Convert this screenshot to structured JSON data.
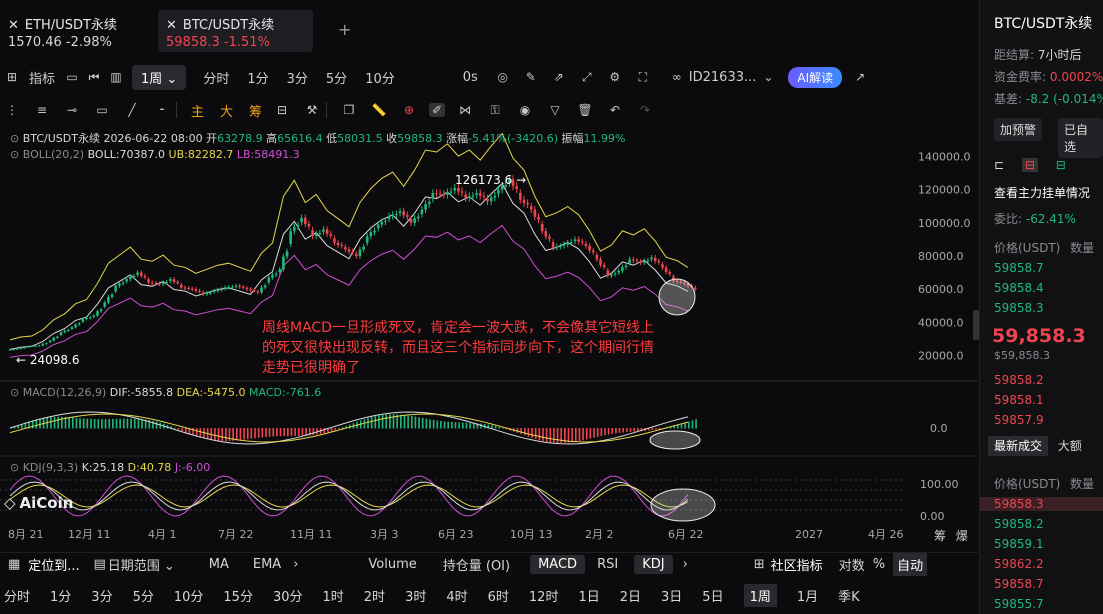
{
  "tabs": [
    {
      "name": "ETH/USDT永续",
      "price": "1570.46",
      "change": "-2.98%"
    },
    {
      "name": "BTC/USDT永续",
      "price": "59858.3",
      "change": "-1.51%"
    }
  ],
  "toolbar": {
    "indicators": "指标",
    "interval": "1周",
    "intervals": [
      "分时",
      "1分",
      "3分",
      "5分",
      "10分"
    ],
    "zero_s": "0s",
    "account": "ID21633...",
    "ai": "AI解读"
  },
  "drawbar": {
    "main": "主",
    "big": "大",
    "chips": "筹"
  },
  "info": {
    "line1_pair": "BTC/USDT永续 2026-06-22 08:00",
    "open_label": "开",
    "open": "63278.9",
    "high_label": "高",
    "high": "65616.4",
    "low_label": "低",
    "low": "58031.5",
    "close_label": "收",
    "close": "59858.3",
    "chg_label": "涨幅",
    "chg": "-5.41%(-3420.6)",
    "amp_label": "振幅",
    "amp": "11.99%",
    "boll_name": "BOLL(20,2)",
    "boll": "BOLL:70387.0",
    "ub": "UB:82282.7",
    "lb": "LB:58491.3",
    "macd_name": "MACD(12,26,9)",
    "dif": "DIF:-5855.8",
    "dea": "DEA:-5475.0",
    "macd": "MACD:-761.6",
    "kdj_name": "KDJ(9,3,3)",
    "k": "K:25.18",
    "d": "D:40.78",
    "j": "J:-6.00"
  },
  "chart_data": {
    "type": "candlestick",
    "title": "BTC/USDT永续 1周",
    "y_ticks": [
      "140000.0",
      "120000.0",
      "100000.0",
      "80000.0",
      "60000.0",
      "40000.0",
      "20000.0"
    ],
    "macd_ticks": [
      "0.0"
    ],
    "kdj_ticks": [
      "100.00",
      "0.00"
    ],
    "x_ticks": [
      "8月 21",
      "12月 11",
      "4月 1",
      "7月 22",
      "11月 11",
      "3月 3",
      "6月 23",
      "10月 13",
      "2月 2",
      "6月 22",
      "2027",
      "4月 26"
    ],
    "max_label": "126173.6 →",
    "min_label": "← 24098.6",
    "ylim": [
      10000,
      150000
    ],
    "price_path": [
      24098,
      25500,
      26000,
      29000,
      34000,
      37000,
      42000,
      44000,
      52000,
      62000,
      66000,
      70000,
      64000,
      63000,
      66000,
      61000,
      60000,
      57000,
      59000,
      61000,
      62000,
      60000,
      58000,
      67000,
      72000,
      95000,
      103000,
      92000,
      96000,
      88000,
      84000,
      80000,
      92000,
      99000,
      104000,
      107000,
      100000,
      108000,
      118000,
      117000,
      121000,
      115000,
      118000,
      113000,
      120000,
      126173,
      114000,
      108000,
      95000,
      85000,
      87000,
      90000,
      86000,
      78000,
      68000,
      71000,
      78000,
      76000,
      79000,
      73000,
      65000,
      63278,
      59858
    ]
  },
  "annotation": "周线MACD一旦形成死叉，肯定会一波大跌，不会像其它短线上的死叉很快出现反转，而且这三个指标同步向下，这个期间行情走势已很明确了",
  "logo": "AiCoin",
  "footer_right": [
    "筹",
    "爆"
  ],
  "bottom1": {
    "locate": "定位到...",
    "range": "日期范围",
    "items": [
      "MA",
      "EMA",
      "Volume",
      "持仓量 (OI)",
      "MACD",
      "RSI",
      "KDJ"
    ],
    "community": "社区指标",
    "log": "对数",
    "pct": "%",
    "auto": "自动"
  },
  "bottom2": [
    "分时",
    "1分",
    "3分",
    "5分",
    "10分",
    "15分",
    "30分",
    "1时",
    "2时",
    "3时",
    "4时",
    "6时",
    "12时",
    "1日",
    "2日",
    "3日",
    "5日",
    "1周",
    "1月",
    "季K"
  ],
  "right": {
    "title": "BTC/USDT永续",
    "settle_label": "距结算:",
    "settle": "7小时后",
    "fund_label": "资金费率:",
    "fund": "0.0002%",
    "basis_label": "基差:",
    "basis": "-8.2 (-0.014%",
    "add_alert": "加预警",
    "added": "已自选",
    "orderbook": "查看主力挂单情况",
    "ratio_label": "委比:",
    "ratio": "-62.41%",
    "col_price": "价格(USDT)",
    "col_qty": "数量",
    "asks": [
      "59858.7",
      "59858.4",
      "59858.3"
    ],
    "last": "59,858.3",
    "last_sub": "$59,858.3",
    "bids": [
      "59858.2",
      "59858.1",
      "59857.9"
    ],
    "trades_tab": "最新成交",
    "big_tab": "大额",
    "trades": [
      {
        "p": "59858.3",
        "c": "red"
      },
      {
        "p": "59858.2",
        "c": "green"
      },
      {
        "p": "59859.1",
        "c": "green"
      },
      {
        "p": "59862.2",
        "c": "red"
      },
      {
        "p": "59858.7",
        "c": "red"
      },
      {
        "p": "59855.7",
        "c": "green"
      }
    ],
    "up_color": "#1fb97a",
    "down_color": "#f0454e"
  }
}
